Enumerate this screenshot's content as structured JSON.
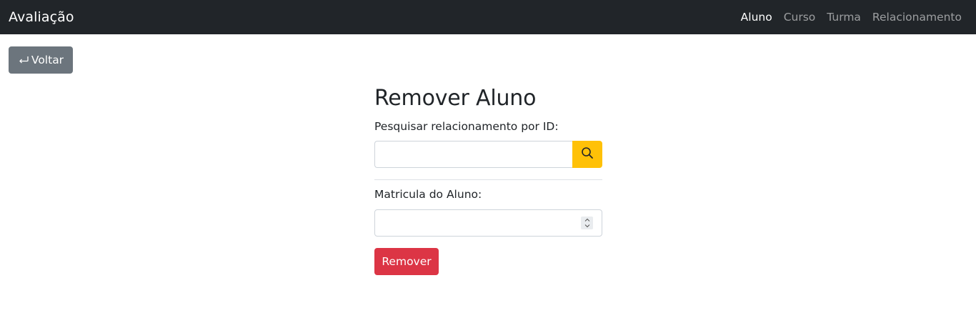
{
  "navbar": {
    "brand": "Avaliação",
    "links": [
      {
        "label": "Aluno",
        "active": true
      },
      {
        "label": "Curso",
        "active": false
      },
      {
        "label": "Turma",
        "active": false
      },
      {
        "label": "Relacionamento",
        "active": false
      }
    ]
  },
  "back_button": {
    "label": "Voltar",
    "icon": "return-arrow-icon"
  },
  "form": {
    "title": "Remover Aluno",
    "search_label": "Pesquisar relacionamento por ID:",
    "search_value": "",
    "search_icon": "search-icon",
    "matricula_label": "Matricula do Aluno:",
    "matricula_value": "",
    "remove_label": "Remover"
  },
  "colors": {
    "navbar_bg": "#212529",
    "back_button_bg": "#6c757d",
    "search_button_bg": "#ffc107",
    "remove_button_bg": "#dc3545"
  }
}
